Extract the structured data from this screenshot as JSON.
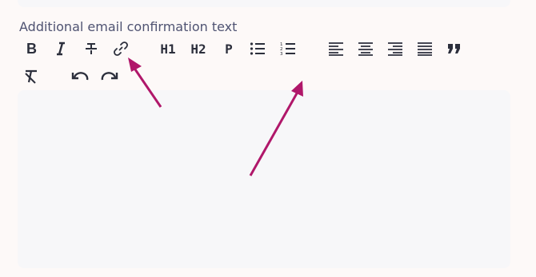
{
  "field": {
    "label": "Additional email confirmation text"
  },
  "toolbar": {
    "buttons": [
      {
        "icon": "bold-icon"
      },
      {
        "icon": "italic-icon"
      },
      {
        "icon": "strikethrough-icon"
      },
      {
        "icon": "link-icon"
      },
      {
        "icon": "heading1-icon",
        "text": "H1"
      },
      {
        "icon": "heading2-icon",
        "text": "H2"
      },
      {
        "icon": "paragraph-icon",
        "text": "P"
      },
      {
        "icon": "bullet-list-icon"
      },
      {
        "icon": "numbered-list-icon"
      },
      {
        "icon": "align-left-icon"
      },
      {
        "icon": "align-center-icon"
      },
      {
        "icon": "align-right-icon"
      },
      {
        "icon": "align-justify-icon"
      },
      {
        "icon": "blockquote-icon"
      },
      {
        "icon": "clear-format-icon"
      },
      {
        "icon": "undo-icon"
      },
      {
        "icon": "redo-icon"
      }
    ]
  },
  "editor": {
    "value": ""
  },
  "colors": {
    "accent_arrow": "#b0176a",
    "label": "#4f5372",
    "icon": "#2c2f3c",
    "editor_bg": "#f7f7f9",
    "page_bg": "#fdf9f8"
  }
}
